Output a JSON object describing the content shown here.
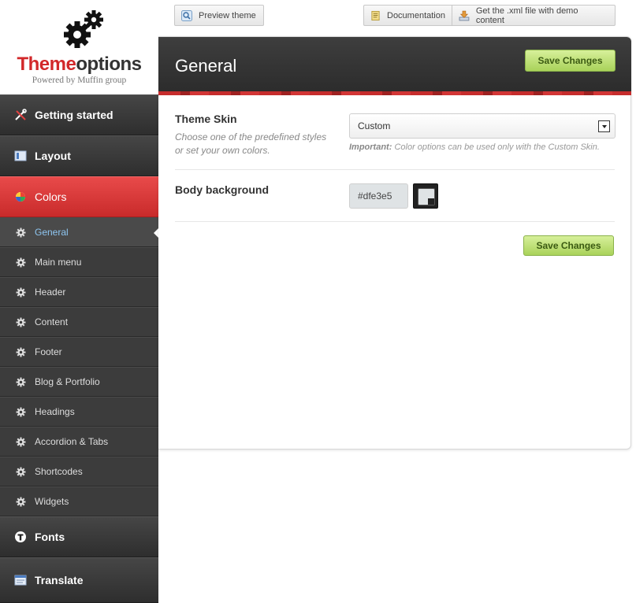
{
  "logo": {
    "brand_prefix": "Theme",
    "brand_suffix": "options",
    "tagline": "Powered by Muffin group"
  },
  "top_buttons": {
    "preview": "Preview theme",
    "docs": "Documentation",
    "xml": "Get the .xml file with demo content"
  },
  "sidebar": {
    "items": [
      {
        "label": "Getting started",
        "icon": "tools-icon"
      },
      {
        "label": "Layout",
        "icon": "layout-icon"
      },
      {
        "label": "Colors",
        "icon": "color-wheel-icon"
      },
      {
        "label": "General",
        "icon": "gear-icon"
      },
      {
        "label": "Main menu",
        "icon": "gear-icon"
      },
      {
        "label": "Header",
        "icon": "gear-icon"
      },
      {
        "label": "Content",
        "icon": "gear-icon"
      },
      {
        "label": "Footer",
        "icon": "gear-icon"
      },
      {
        "label": "Blog & Portfolio",
        "icon": "gear-icon"
      },
      {
        "label": "Headings",
        "icon": "gear-icon"
      },
      {
        "label": "Accordion & Tabs",
        "icon": "gear-icon"
      },
      {
        "label": "Shortcodes",
        "icon": "gear-icon"
      },
      {
        "label": "Widgets",
        "icon": "gear-icon"
      },
      {
        "label": "Fonts",
        "icon": "font-icon"
      },
      {
        "label": "Translate",
        "icon": "translate-icon"
      }
    ]
  },
  "panel": {
    "title": "General",
    "save_label": "Save Changes",
    "theme_skin": {
      "label": "Theme Skin",
      "description": "Choose one of the predefined styles or set your own colors.",
      "selected": "Custom",
      "note_strong": "Important:",
      "note_text": " Color options can be used only with the Custom Skin."
    },
    "body_background": {
      "label": "Body background",
      "value": "#dfe3e5"
    }
  },
  "colors": {
    "accent_red": "#d2282a",
    "save_green": "#a9d25a",
    "body_bg": "#dfe3e5"
  }
}
